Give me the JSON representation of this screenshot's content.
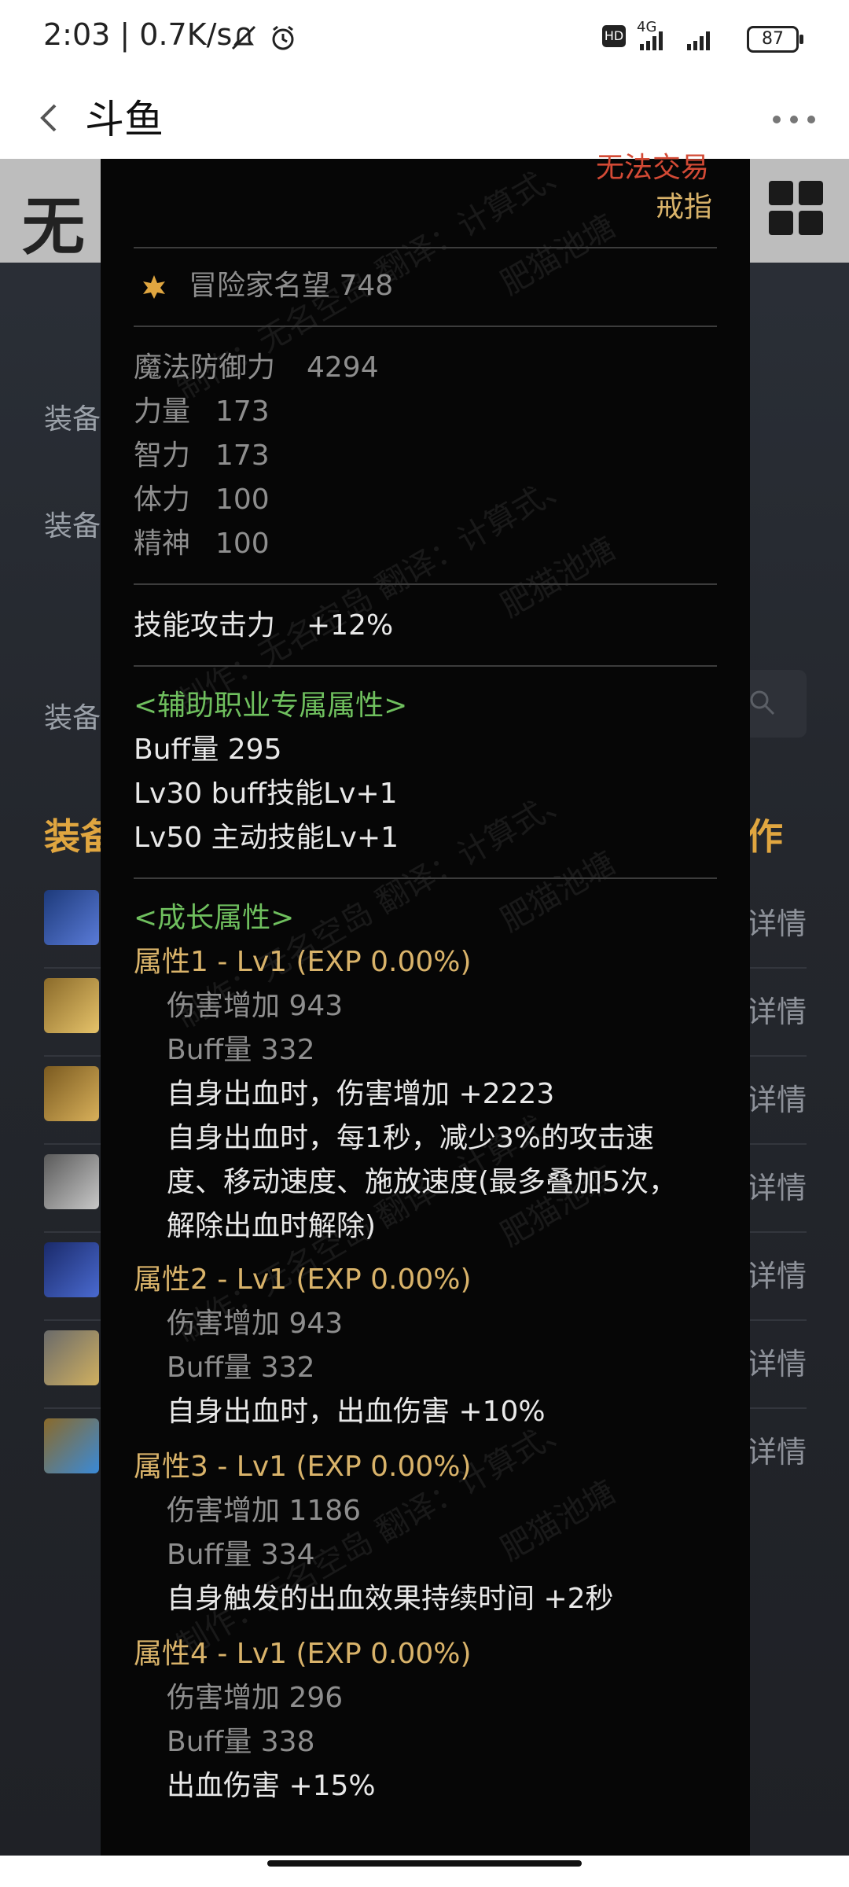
{
  "status_bar": {
    "time_speed": "2:03 | 0.7K/s",
    "network_label": "4G",
    "hd_label": "HD",
    "battery": "87"
  },
  "app_bar": {
    "title": "斗鱼"
  },
  "background_page": {
    "logo_char": "无",
    "side_labels": [
      "装备",
      "装备",
      "装备"
    ],
    "equip_title_left": "装备",
    "equip_title_right": "作",
    "detail_link": "详情"
  },
  "tooltip": {
    "trade_status": "无法交易",
    "item_type": "戒指",
    "fame": "冒险家名望 748",
    "stats": [
      {
        "label": "魔法防御力",
        "value": "4294"
      },
      {
        "label": "力量",
        "value": "173"
      },
      {
        "label": "智力",
        "value": "173"
      },
      {
        "label": "体力",
        "value": "100"
      },
      {
        "label": "精神",
        "value": "100"
      }
    ],
    "skill_attack": {
      "label": "技能攻击力",
      "value": "+12%"
    },
    "support_header": "<辅助职业专属属性>",
    "support_lines": [
      "Buff量   295",
      "Lv30 buff技能Lv+1",
      "Lv50 主动技能Lv+1"
    ],
    "growth_header": "<成长属性>",
    "growth": [
      {
        "title": "属性1 - Lv1 (EXP 0.00%)",
        "dmg": "伤害增加   943",
        "buff": "Buff量   332",
        "effects": [
          "自身出血时，伤害增加 +2223",
          "自身出血时，每1秒，减少3%的攻击速",
          "度、移动速度、施放速度(最多叠加5次，",
          "解除出血时解除)"
        ]
      },
      {
        "title": "属性2 - Lv1 (EXP 0.00%)",
        "dmg": "伤害增加   943",
        "buff": "Buff量   332",
        "effects": [
          "自身出血时，出血伤害 +10%"
        ]
      },
      {
        "title": "属性3 - Lv1 (EXP 0.00%)",
        "dmg": "伤害增加   1186",
        "buff": "Buff量   334",
        "effects": [
          "自身触发的出血效果持续时间 +2秒"
        ]
      },
      {
        "title": "属性4 - Lv1 (EXP 0.00%)",
        "dmg": "伤害增加   296",
        "buff": "Buff量   338",
        "effects": [
          "出血伤害 +15%"
        ]
      }
    ],
    "watermark_a": "制作：无名空岛 翻译：计算式、",
    "watermark_b": "肥猫池塘"
  }
}
